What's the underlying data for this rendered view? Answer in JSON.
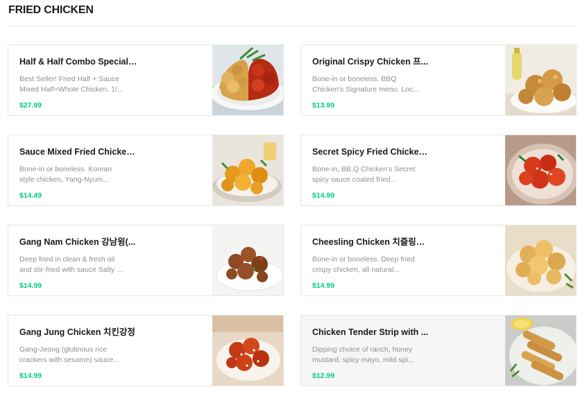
{
  "section": {
    "title": "FRIED CHICKEN"
  },
  "items": [
    {
      "name": "Half & Half Combo Special ...",
      "desc1": "Best Seller! Fried Half + Sauce",
      "desc2": "Mixed Half=Whole Chicken. 1/...",
      "price": "$27.99",
      "image": "half-half-combo-photo"
    },
    {
      "name": "Original Crispy Chicken 프...",
      "desc1": "Bone-in or boneless. BBQ",
      "desc2": "Chicken's Signature menu. Loc...",
      "price": "$13.99",
      "image": "original-crispy-photo"
    },
    {
      "name": "Sauce Mixed Fried Chicken...",
      "desc1": "Bone-in or boneless. Korean",
      "desc2": "style chicken, Yang-Nyum...",
      "price": "$14.49",
      "image": "sauce-mixed-photo"
    },
    {
      "name": "Secret Spicy Fried Chicken ...",
      "desc1": "Bone-in, BB.Q Chicken's Secret",
      "desc2": "spicy sauce coated fried...",
      "price": "$14.99",
      "image": "secret-spicy-photo"
    },
    {
      "name": "Gang Nam Chicken 강남윙(...",
      "desc1": "Deep fried in clean & fresh oil",
      "desc2": "and stir-fried with sauce Salty ...",
      "price": "$14.99",
      "image": "gang-nam-photo"
    },
    {
      "name": "Cheesling Chicken 치즐링치킨",
      "desc1": "Bone-in or boneless. Deep fried",
      "desc2": "crispy chicken, all natural...",
      "price": "$14.99",
      "image": "cheesling-photo"
    },
    {
      "name": "Gang Jung Chicken 치킨강정",
      "desc1": "Gang-Jeong (glutinous rice",
      "desc2": "crackers with sesame) sauce...",
      "price": "$14.99",
      "image": "gang-jung-photo"
    },
    {
      "name": "Chicken Tender Strip with ...",
      "desc1": "Dipping choice of ranch, honey",
      "desc2": "mustard, spicy mayo, mild spi...",
      "price": "$12.99",
      "image": "tender-strip-photo"
    }
  ],
  "colors": {
    "price": "#00cc88",
    "title": "#191919",
    "desc": "#8f8f8f",
    "border": "#e6e6e6"
  }
}
